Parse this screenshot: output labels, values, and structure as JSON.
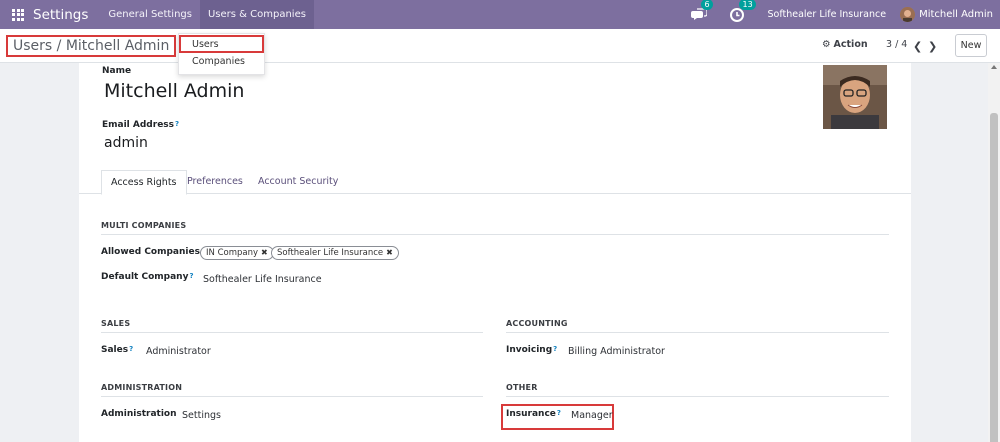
{
  "navbar": {
    "app_title": "Settings",
    "menus": [
      "General Settings",
      "Users & Companies"
    ],
    "messages_count": "6",
    "activities_count": "13",
    "company": "Softhealer Life Insurance",
    "user": "Mitchell Admin",
    "color": "#7d6f9f"
  },
  "breadcrumb": "Users / Mitchell Admin",
  "controls": {
    "action_label": "Action",
    "pager": "3 / 4",
    "new_label": "New"
  },
  "dropdown": {
    "items": [
      "Users",
      "Companies"
    ]
  },
  "form": {
    "name_label": "Name",
    "name_value": "Mitchell Admin",
    "email_label": "Email Address",
    "email_help": "?",
    "email_value": "admin",
    "tabs": [
      "Access Rights",
      "Preferences",
      "Account Security"
    ],
    "multi_companies": {
      "title": "MULTI COMPANIES",
      "allowed_label": "Allowed Companies",
      "allowed_tags": [
        "IN Company",
        "Softhealer Life Insurance"
      ],
      "default_label": "Default Company",
      "default_value": "Softhealer Life Insurance"
    },
    "sales": {
      "title": "SALES",
      "label": "Sales",
      "value": "Administrator"
    },
    "accounting": {
      "title": "ACCOUNTING",
      "label": "Invoicing",
      "value": "Billing Administrator"
    },
    "administration": {
      "title": "ADMINISTRATION",
      "label": "Administration",
      "value": "Settings"
    },
    "other": {
      "title": "OTHER",
      "label": "Insurance",
      "value": "Manager"
    }
  },
  "icons": {
    "tag_remove": "✖",
    "help": "?",
    "prev": "❮",
    "next": "❯",
    "gear": "⚙"
  }
}
